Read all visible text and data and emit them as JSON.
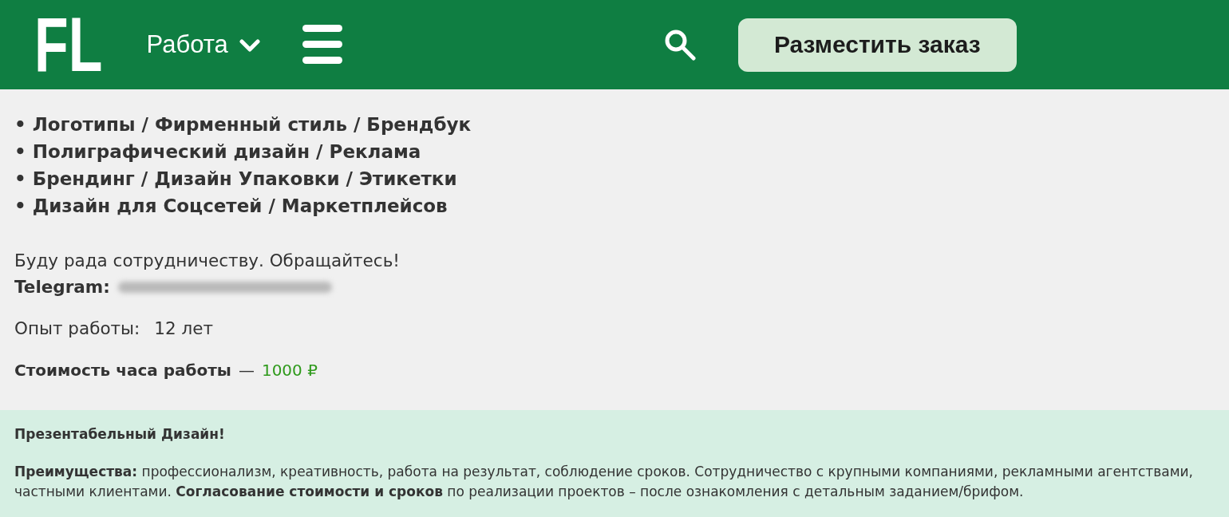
{
  "header": {
    "logo": "FL",
    "nav_menu": {
      "label": "Работа",
      "expanded": false
    },
    "order_button": "Разместить заказ"
  },
  "services": [
    "• Логотипы / Фирменный стиль / Брендбук",
    "• Полиграфический дизайн / Реклама",
    "• Брендинг / Дизайн Упаковки / Этикетки",
    "• Дизайн для Соцсетей / Маркетплейсов"
  ],
  "contact": {
    "greeting": "Буду рада сотрудничеству. Обращайтесь!",
    "telegram_label": "Telegram:",
    "handle_blurred": true
  },
  "experience": {
    "label": "Опыт работы:",
    "value": "12 лет"
  },
  "rate": {
    "label": "Стоимость часа работы",
    "separator": "—",
    "value": "1000 ₽"
  },
  "about": {
    "title": "Презентабельный Дизайн!",
    "text": "**Преимущества:** профессионализм, креативность, работа на результат, соблюдение сроков. Сотрудничество с крупными компаниями, рекламными агентствами, частными клиентами. **Согласование стоимости и сроков** по реализации проектов – после ознакомления с детальным заданием/брифом."
  }
}
